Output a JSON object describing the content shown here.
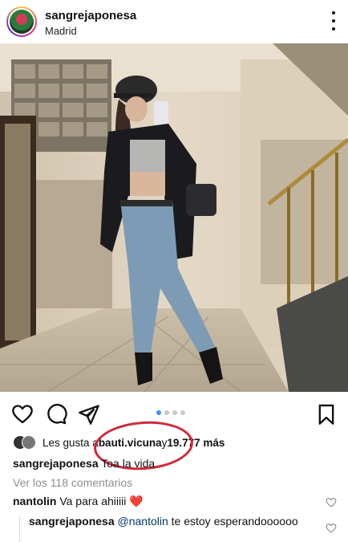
{
  "header": {
    "username": "sangrejaponesa",
    "location": "Madrid"
  },
  "carousel": {
    "count": 4,
    "active_index": 0
  },
  "likes": {
    "prefix": "Les gusta a ",
    "user": "bauti.vicuna",
    "connector": " y ",
    "count": "19.777 más"
  },
  "caption": {
    "username": "sangrejaponesa",
    "text": " Toa la vida"
  },
  "view_comments": "Ver los 118 comentarios",
  "comments": [
    {
      "username": "nantolin",
      "text": " Va para ahiiiii ",
      "emoji": "❤️"
    }
  ],
  "reply": {
    "username": "sangrejaponesa",
    "mention": "@nantolin",
    "text": " te estoy esperandoooooo"
  },
  "colors": {
    "accent": "#3897f0",
    "annotation": "#d0283a",
    "heart": "#ed4956"
  }
}
